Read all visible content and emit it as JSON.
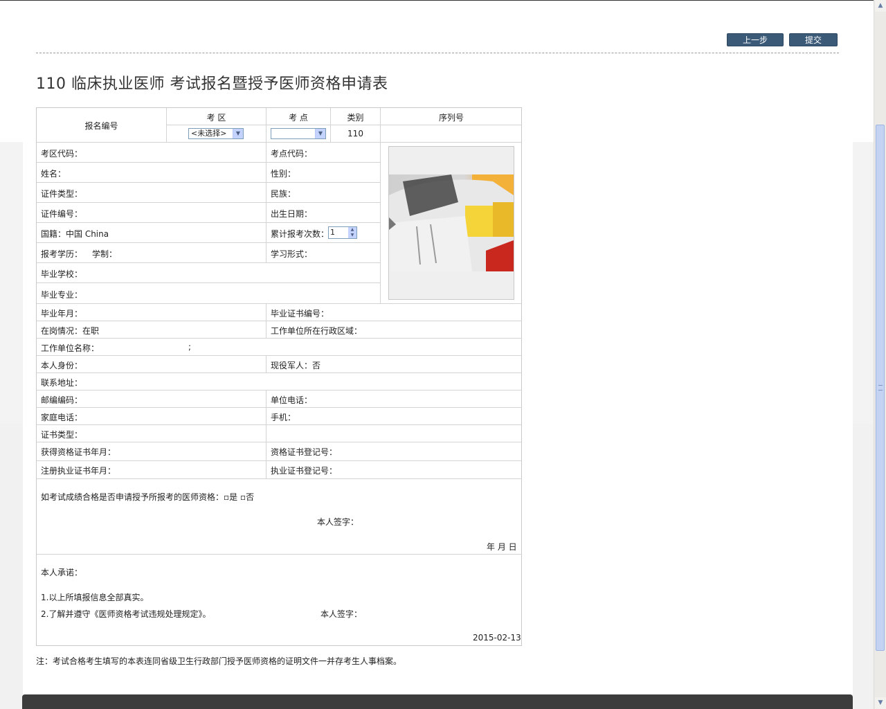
{
  "toolbar": {
    "prev_label": "上一步",
    "submit_label": "提交"
  },
  "title": "110 临床执业医师 考试报名暨授予医师资格申请表",
  "header": {
    "reg_no_label": "报名编号",
    "exam_area_label": "考 区",
    "exam_site_label": "考 点",
    "category_label": "类别",
    "serial_label": "序列号",
    "exam_area_value": "<未选择>",
    "exam_site_value": "",
    "category_value": "110"
  },
  "fields": {
    "area_code": "考区代码：",
    "site_code": "考点代码：",
    "name": "姓名：",
    "gender": "性别：",
    "id_type": "证件类型：",
    "ethnicity": "民族：",
    "id_no": "证件编号：",
    "birth_date": "出生日期：",
    "nationality": "国籍：中国 China",
    "exam_count": "累计报考次数：",
    "exam_count_value": "1",
    "education": "报考学历：",
    "schooling": "学制：",
    "study_form": "学习形式：",
    "school": "毕业学校：",
    "major": "毕业专业：",
    "grad_date": "毕业年月：",
    "grad_cert_no": "毕业证书编号：",
    "job_status": "在岗情况：在职",
    "work_region": "工作单位所在行政区域：",
    "work_unit": "工作单位名称：",
    "work_unit_mark": ";",
    "identity": "本人身份：",
    "military": "现役军人：否",
    "address": "联系地址：",
    "postcode": "邮编编码：",
    "unit_phone": "单位电话：",
    "home_phone": "家庭电话：",
    "mobile": "手机：",
    "cert_type": "证书类型：",
    "qual_cert_date": "获得资格证书年月：",
    "qual_cert_no": "资格证书登记号：",
    "reg_cert_date": "注册执业证书年月：",
    "practice_cert_no": "执业证书登记号："
  },
  "apply": {
    "question": "如考试成绩合格是否申请授予所报考的医师资格：▫是 ▫否",
    "signature": "本人签字：",
    "date": "年 月 日"
  },
  "promise": {
    "heading": "本人承诺：",
    "item1": "1.以上所填报信息全部真实。",
    "item2": "2.了解并遵守《医师资格考试违规处理规定》。",
    "signature": "本人签字：",
    "date": "2015-02-13"
  },
  "note": "注：考试合格考生填写的本表连同省级卫生行政部门授予医师资格的证明文件一并存考生人事档案。",
  "icons": {
    "dropdown": "chevron-down-icon",
    "scroll_up": "arrow-up-icon",
    "scroll_down": "arrow-down-icon"
  },
  "colors": {
    "button_bg": "#3b5a78",
    "footer_bg": "#3c3c3c",
    "border": "#c9c9c9"
  }
}
